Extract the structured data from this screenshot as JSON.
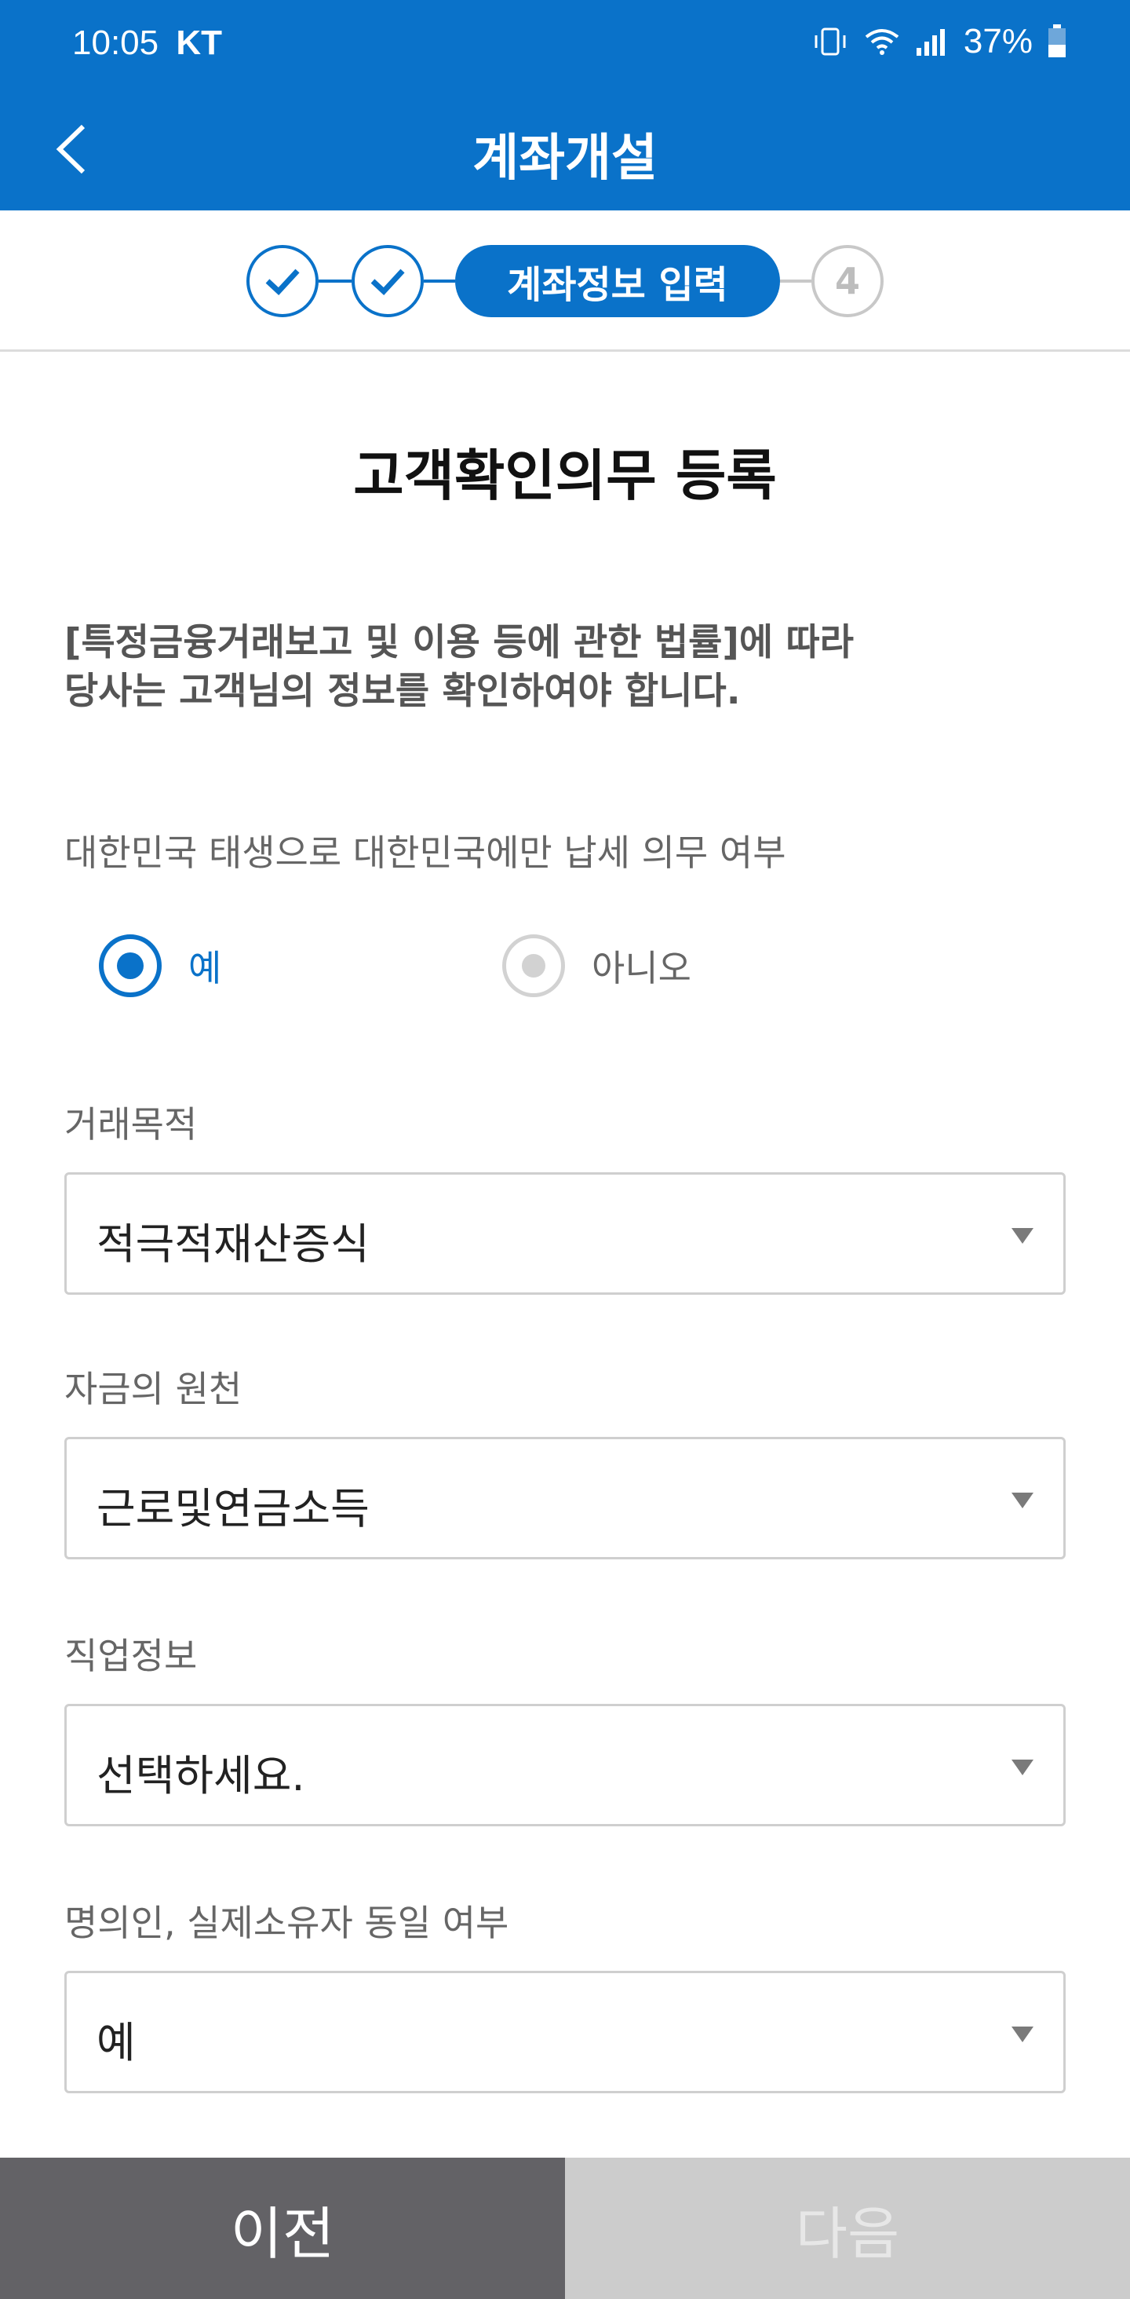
{
  "status_bar": {
    "time": "10:05",
    "carrier": "KT",
    "battery": "37%"
  },
  "header": {
    "title": "계좌개설"
  },
  "stepper": {
    "current_label": "계좌정보 입력",
    "next_number": "4"
  },
  "page": {
    "title": "고객확인의무 등록",
    "notice_line1": "[특정금융거래보고 및 이용 등에 관한 법률]에 따라",
    "notice_line2": "당사는 고객님의 정보를 확인하여야 합니다."
  },
  "tax_question": {
    "label": "대한민국 태생으로 대한민국에만 납세 의무 여부",
    "option_yes": "예",
    "option_no": "아니오",
    "selected": "예"
  },
  "fields": {
    "purpose": {
      "label": "거래목적",
      "value": "적극적재산증식"
    },
    "fund_source": {
      "label": "자금의 원천",
      "value": "근로및연금소득"
    },
    "job": {
      "label": "직업정보",
      "value": "선택하세요."
    },
    "owner_same": {
      "label": "명의인, 실제소유자 동일 여부",
      "value": "예"
    }
  },
  "buttons": {
    "prev": "이전",
    "next": "다음"
  },
  "colors": {
    "primary": "#0a72c9",
    "prev_button": "#636266",
    "next_button_disabled": "#cccccc"
  }
}
